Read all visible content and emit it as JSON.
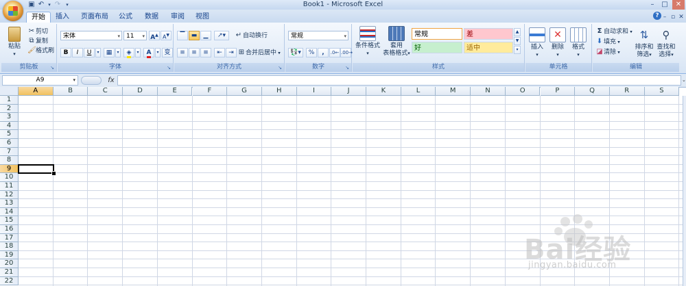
{
  "title": "Book1 - Microsoft Excel",
  "tabs": [
    "开始",
    "插入",
    "页面布局",
    "公式",
    "数据",
    "审阅",
    "视图"
  ],
  "clipboard": {
    "paste": "粘贴",
    "cut": "剪切",
    "copy": "复制",
    "format_painter": "格式刷",
    "label": "剪贴板"
  },
  "font": {
    "name": "宋体",
    "size": "11",
    "bold": "B",
    "italic": "I",
    "underline": "U",
    "increase": "A",
    "decrease": "A",
    "color_letter": "A",
    "phonetic": "变",
    "label": "字体"
  },
  "alignment": {
    "wrap_text": "自动换行",
    "merge_center": "合并后居中",
    "label": "对齐方式"
  },
  "number": {
    "format": "常规",
    "percent": "%",
    "comma": ",",
    "label": "数字"
  },
  "styles": {
    "conditional": "条件格式",
    "table_line1": "套用",
    "table_line2": "表格格式",
    "normal": "常规",
    "bad": "差",
    "good": "好",
    "neutral": "适中",
    "label": "样式"
  },
  "cells": {
    "insert": "插入",
    "delete": "删除",
    "format": "格式",
    "label": "单元格"
  },
  "editing": {
    "autosum": "自动求和",
    "fill": "填充",
    "clear": "清除",
    "sort_line1": "排序和",
    "sort_line2": "筛选",
    "find_line1": "查找和",
    "find_line2": "选择",
    "label": "编辑"
  },
  "formula_bar": {
    "name_box": "A9",
    "fx": "fx",
    "content": ""
  },
  "grid": {
    "columns": [
      "A",
      "B",
      "C",
      "D",
      "E",
      "F",
      "G",
      "H",
      "I",
      "J",
      "K",
      "L",
      "M",
      "N",
      "O",
      "P",
      "Q",
      "R",
      "S"
    ],
    "rows": [
      "1",
      "2",
      "3",
      "4",
      "5",
      "6",
      "7",
      "8",
      "9",
      "10",
      "11",
      "12",
      "13",
      "14",
      "15",
      "16",
      "17",
      "18",
      "19",
      "20",
      "21",
      "22"
    ],
    "active_column": "A",
    "active_row": "9"
  },
  "watermark": {
    "brand": "Bai经验",
    "url": "jingyan.baidu.com"
  },
  "colors": {
    "ribbon_bg": "#e4edf8",
    "selected_header": "#f1c15f",
    "style_bad_bg": "#ffc7ce",
    "style_bad_fg": "#9c0006",
    "style_good_bg": "#c6efce",
    "style_good_fg": "#006100",
    "style_neutral_bg": "#ffeb9c",
    "style_neutral_fg": "#9c6500"
  }
}
